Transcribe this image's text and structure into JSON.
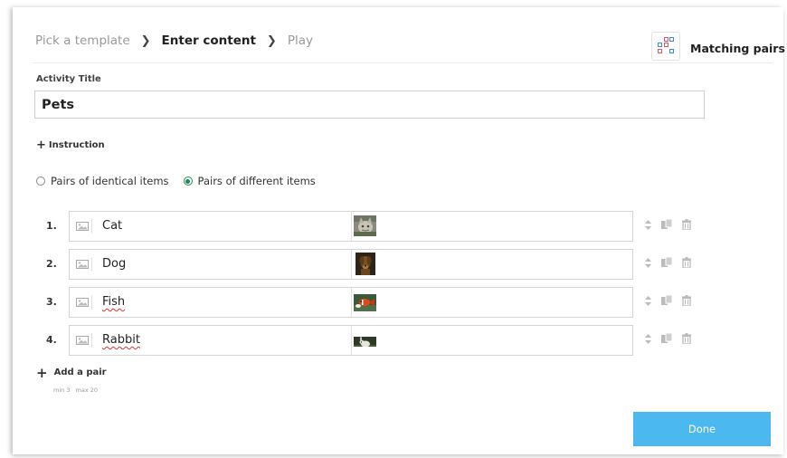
{
  "breadcrumb": {
    "step1": "Pick a template",
    "step2": "Enter content",
    "step3": "Play",
    "separator": "❯"
  },
  "template": {
    "name": "Matching pairs",
    "icon": "matching-pairs-icon"
  },
  "activity_title": {
    "label": "Activity Title",
    "value": "Pets"
  },
  "instruction": {
    "label": "Instruction",
    "icon": "plus-icon"
  },
  "pair_mode": {
    "options": [
      "Pairs of identical items",
      "Pairs of different items"
    ],
    "selected": "Pairs of different items",
    "accent": "#1d8a59"
  },
  "pairs": [
    {
      "num": "1.",
      "text": "Cat",
      "spellcheck": false,
      "image": "cat-photo"
    },
    {
      "num": "2.",
      "text": "Dog",
      "spellcheck": false,
      "image": "dog-photo"
    },
    {
      "num": "3.",
      "text": "Fish",
      "spellcheck": true,
      "image": "fish-photo"
    },
    {
      "num": "4.",
      "text": "Rabbit",
      "spellcheck": true,
      "image": "rabbit-photo"
    }
  ],
  "add_pair": {
    "label": "Add a pair",
    "min": "min 3",
    "max": "max 20"
  },
  "done": {
    "label": "Done",
    "color": "#4bb8f0"
  }
}
